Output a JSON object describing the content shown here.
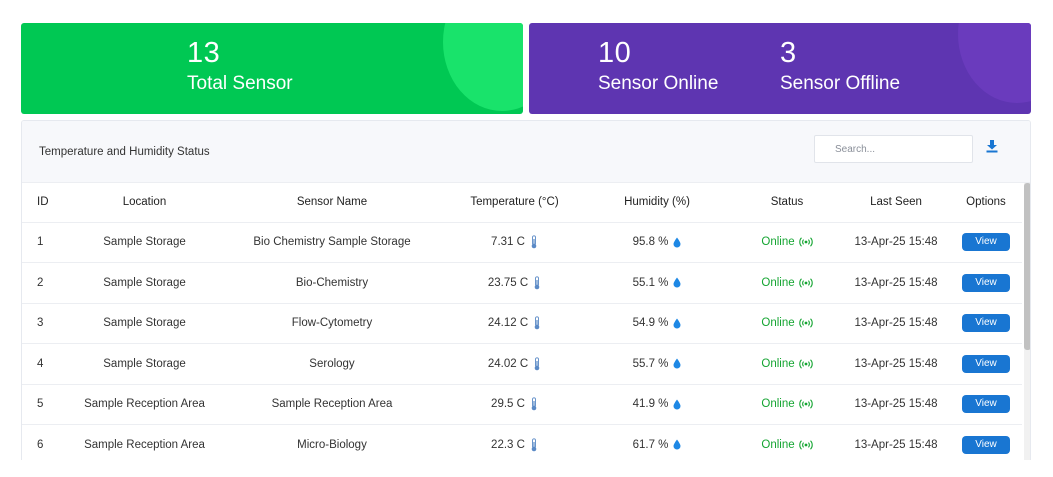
{
  "stats": {
    "total": {
      "value": "13",
      "label": "Total Sensor"
    },
    "online": {
      "value": "10",
      "label": "Sensor Online"
    },
    "offline": {
      "value": "3",
      "label": "Sensor Offline"
    }
  },
  "panel": {
    "title": "Temperature and Humidity Status",
    "search_placeholder": "Search..."
  },
  "table": {
    "headers": [
      "ID",
      "Location",
      "Sensor Name",
      "Temperature (°C)",
      "Humidity (%)",
      "Status",
      "Last Seen",
      "Options"
    ],
    "rows": [
      {
        "id": "1",
        "location": "Sample Storage",
        "sensor": "Bio Chemistry Sample Storage",
        "temperature": "7.31 C",
        "humidity": "95.8 %",
        "status": "Online",
        "last_seen": "13-Apr-25 15:48",
        "action": "View"
      },
      {
        "id": "2",
        "location": "Sample Storage",
        "sensor": "Bio-Chemistry",
        "temperature": "23.75 C",
        "humidity": "55.1 %",
        "status": "Online",
        "last_seen": "13-Apr-25 15:48",
        "action": "View"
      },
      {
        "id": "3",
        "location": "Sample Storage",
        "sensor": "Flow-Cytometry",
        "temperature": "24.12 C",
        "humidity": "54.9 %",
        "status": "Online",
        "last_seen": "13-Apr-25 15:48",
        "action": "View"
      },
      {
        "id": "4",
        "location": "Sample Storage",
        "sensor": "Serology",
        "temperature": "24.02 C",
        "humidity": "55.7 %",
        "status": "Online",
        "last_seen": "13-Apr-25 15:48",
        "action": "View"
      },
      {
        "id": "5",
        "location": "Sample Reception Area",
        "sensor": "Sample Reception Area",
        "temperature": "29.5 C",
        "humidity": "41.9 %",
        "status": "Online",
        "last_seen": "13-Apr-25 15:48",
        "action": "View"
      },
      {
        "id": "6",
        "location": "Sample Reception Area",
        "sensor": "Micro-Biology",
        "temperature": "22.3 C",
        "humidity": "61.7 %",
        "status": "Online",
        "last_seen": "13-Apr-25 15:48",
        "action": "View"
      }
    ]
  },
  "colors": {
    "green_card": "#00c853",
    "purple_card": "#5e35b1",
    "online": "#15a532",
    "button": "#1976d2"
  },
  "icons": {
    "temperature": "thermometer-icon",
    "humidity": "water-drop-icon",
    "status": "signal-icon",
    "download": "download-icon"
  }
}
